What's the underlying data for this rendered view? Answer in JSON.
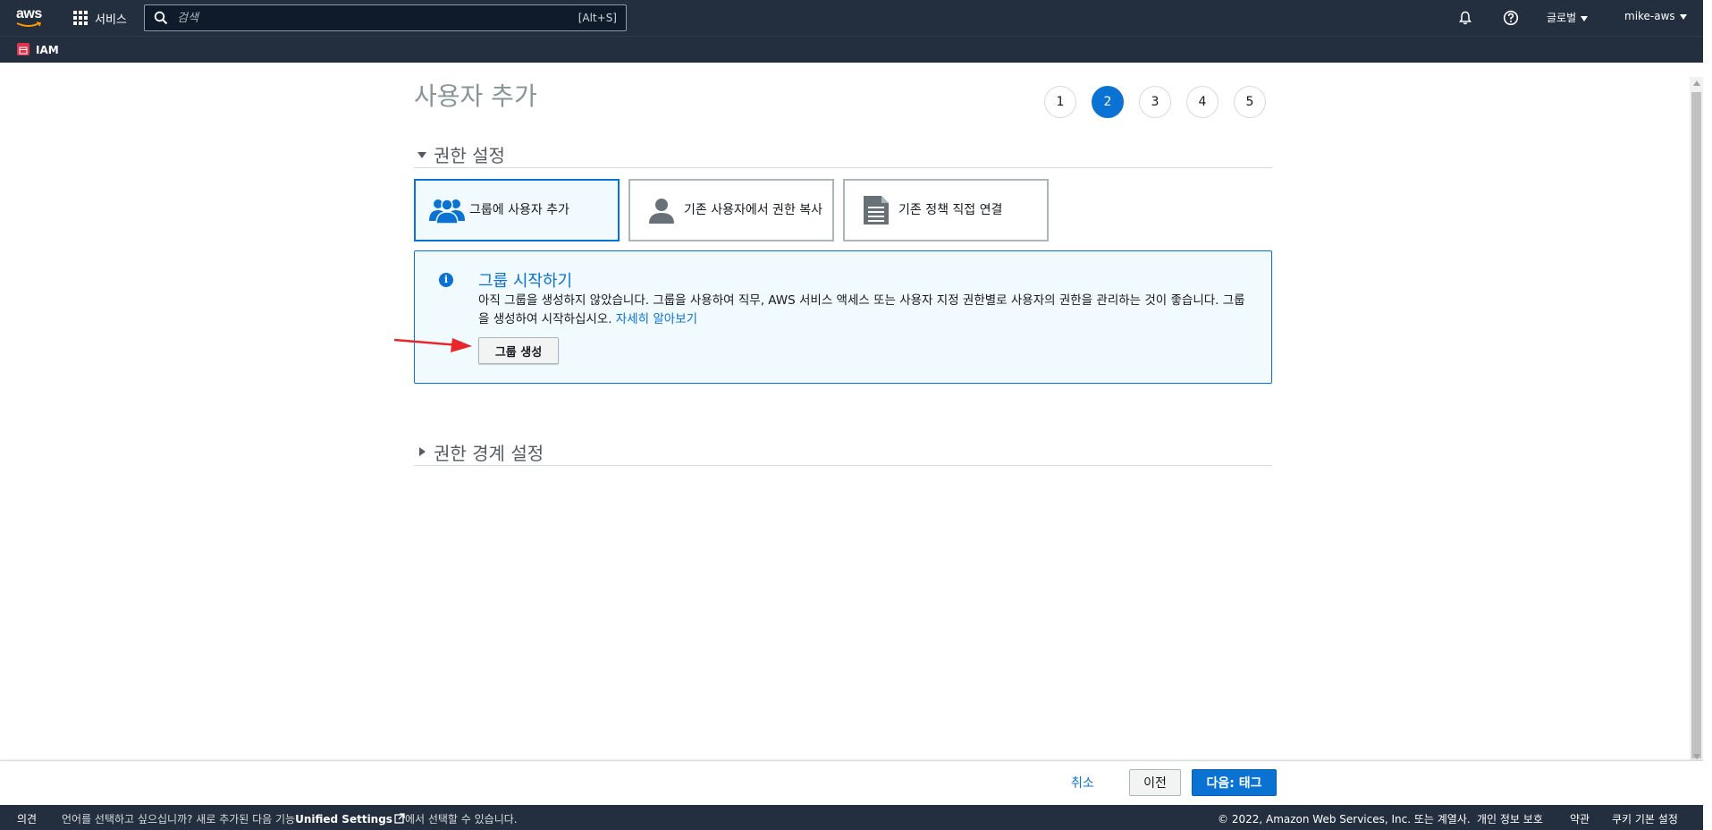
{
  "topnav": {
    "logo_text": "aws",
    "services_label": "서비스",
    "search_placeholder": "검색",
    "search_shortcut": "[Alt+S]",
    "region_label": "글로벌",
    "user_label": "mike-aws",
    "icons": [
      "grid-icon",
      "search-icon",
      "bell-icon",
      "help-icon"
    ]
  },
  "subbar": {
    "service_label": "IAM",
    "badge_color": "#dd344c"
  },
  "page": {
    "title": "사용자 추가",
    "steps": [
      "1",
      "2",
      "3",
      "4",
      "5"
    ],
    "active_step": "2"
  },
  "permissions": {
    "section_title": "권한 설정",
    "options": [
      {
        "label": "그룹에 사용자 추가",
        "icon": "group-icon",
        "selected": true
      },
      {
        "label": "기존 사용자에서 권한 복사",
        "icon": "user-icon",
        "selected": false
      },
      {
        "label": "기존 정책 직접 연결",
        "icon": "document-icon",
        "selected": false
      }
    ],
    "info": {
      "icon": "info-icon",
      "title": "그룹 시작하기",
      "body": "아직 그룹을 생성하지 않았습니다. 그룹을 사용하여 직무, AWS 서비스 액세스 또는 사용자 지정 권한별로 사용자의 권한을 관리하는 것이 좋습니다. 그룹을 생성하여 시작하십시오.",
      "link": "자세히 알아보기",
      "button": "그룹 생성"
    }
  },
  "boundary": {
    "section_title": "권한 경계 설정"
  },
  "actions": {
    "cancel": "취소",
    "previous": "이전",
    "next": "다음: 태그"
  },
  "footer": {
    "feedback": "의견",
    "lang_prefix": "언어를 선택하고 싶으십니까? 새로 추가된 다음 기능",
    "lang_link": "Unified Settings",
    "lang_suffix": "에서 선택할 수 있습니다.",
    "copyright": "© 2022, Amazon Web Services, Inc. 또는 계열사.",
    "privacy": "개인 정보 보호",
    "terms": "약관",
    "cookies": "쿠키 기본 설정"
  },
  "colors": {
    "nav_bg": "#232f3e",
    "primary": "#0972d3",
    "info_bg": "#f1faff",
    "arrow": "#e8262b"
  }
}
